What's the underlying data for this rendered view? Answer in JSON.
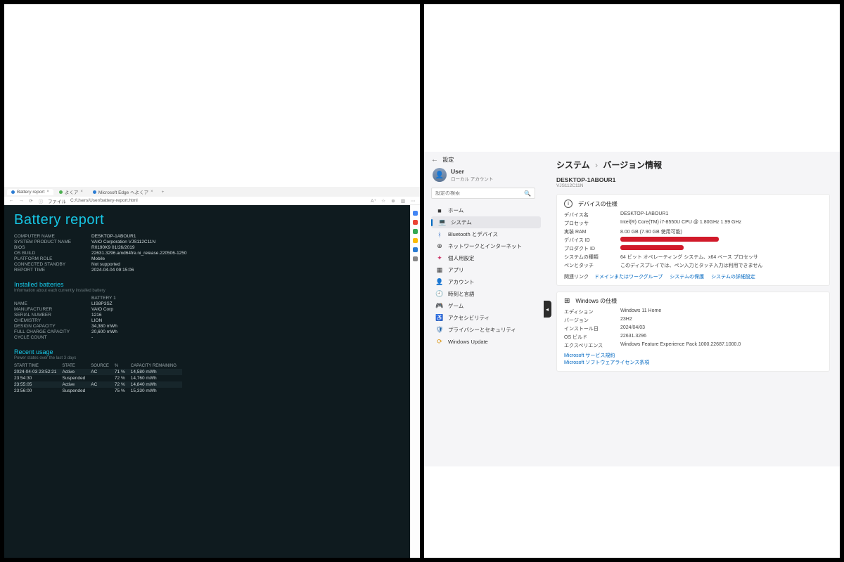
{
  "left": {
    "tabs": [
      {
        "label": "Battery report",
        "active": true
      },
      {
        "label": "よくア",
        "active": false
      },
      {
        "label": "Microsoft Edge へよくア",
        "active": false
      }
    ],
    "addr_prefix": "ファイル",
    "url": "C:/Users/User/battery-report.html",
    "title": "Battery report",
    "sys": [
      {
        "k": "COMPUTER NAME",
        "v": "DESKTOP-1ABOUR1"
      },
      {
        "k": "SYSTEM PRODUCT NAME",
        "v": "VAIO Corporation VJS112C11N"
      },
      {
        "k": "BIOS",
        "v": "R0190K9 01/26/2019"
      },
      {
        "k": "OS BUILD",
        "v": "22631.3296.amd64fre.ni_release.220506-1250"
      },
      {
        "k": "PLATFORM ROLE",
        "v": "Mobile"
      },
      {
        "k": "CONNECTED STANDBY",
        "v": "Not supported"
      },
      {
        "k": "REPORT TIME",
        "v": "2024-04-04 09:15:06"
      }
    ],
    "inst_title": "Installed batteries",
    "inst_sub": "Information about each currently installed battery",
    "batt_col": "BATTERY 1",
    "batt": [
      {
        "k": "NAME",
        "v": "LIS8P3SZ"
      },
      {
        "k": "MANUFACTURER",
        "v": "VAIO Corp"
      },
      {
        "k": "SERIAL NUMBER",
        "v": "1216"
      },
      {
        "k": "CHEMISTRY",
        "v": "LION"
      },
      {
        "k": "DESIGN CAPACITY",
        "v": "34,380 mWh"
      },
      {
        "k": "FULL CHARGE CAPACITY",
        "v": "20,600 mWh"
      },
      {
        "k": "CYCLE COUNT",
        "v": "-"
      }
    ],
    "recent_title": "Recent usage",
    "recent_sub": "Power states over the last 3 days",
    "recent_cols": [
      "START TIME",
      "STATE",
      "SOURCE",
      "%",
      "CAPACITY REMAINING"
    ],
    "recent": [
      {
        "t": "2024-04-03  23:52:21",
        "st": "Active",
        "src": "AC",
        "p": "71 %",
        "c": "14,580 mWh"
      },
      {
        "t": "23:54:30",
        "st": "Suspended",
        "src": "",
        "p": "72 %",
        "c": "14,760 mWh"
      },
      {
        "t": "23:55:05",
        "st": "Active",
        "src": "AC",
        "p": "72 %",
        "c": "14,840 mWh"
      },
      {
        "t": "23:56:00",
        "st": "Suspended",
        "src": "",
        "p": "75 %",
        "c": "15,330 mWh"
      }
    ]
  },
  "right": {
    "app_title": "設定",
    "user_name": "User",
    "user_sub": "ローカル アカウント",
    "search_ph": "設定の検索",
    "nav": [
      {
        "icon": "■",
        "cls": "ic-sys",
        "label": "ホーム"
      },
      {
        "icon": "💻",
        "cls": "ic-sys",
        "label": "システム",
        "sel": true
      },
      {
        "icon": "ᚼ",
        "cls": "ic-bt",
        "label": "Bluetooth とデバイス"
      },
      {
        "icon": "⊕",
        "cls": "ic-net",
        "label": "ネットワークとインターネット"
      },
      {
        "icon": "✦",
        "cls": "ic-pers",
        "label": "個人用設定"
      },
      {
        "icon": "▦",
        "cls": "ic-app",
        "label": "アプリ"
      },
      {
        "icon": "👤",
        "cls": "ic-acct",
        "label": "アカウント"
      },
      {
        "icon": "🕘",
        "cls": "ic-time",
        "label": "時刻と言語"
      },
      {
        "icon": "🎮",
        "cls": "ic-game",
        "label": "ゲーム"
      },
      {
        "icon": "♿",
        "cls": "ic-acc",
        "label": "アクセシビリティ"
      },
      {
        "icon": "🛡",
        "cls": "ic-priv",
        "label": "プライバシーとセキュリティ"
      },
      {
        "icon": "⟳",
        "cls": "ic-upd",
        "label": "Windows Update"
      }
    ],
    "crumb_sys": "システム",
    "crumb_sep": "›",
    "crumb_page": "バージョン情報",
    "dev_name": "DESKTOP-1ABOUR1",
    "dev_model": "VJS112C11N",
    "spec_title": "デバイスの仕様",
    "specs": [
      {
        "k": "デバイス名",
        "v": "DESKTOP-1ABOUR1"
      },
      {
        "k": "プロセッサ",
        "v": "Intel(R) Core(TM) i7-8550U CPU @ 1.80GHz   1.99 GHz"
      },
      {
        "k": "実装 RAM",
        "v": "8.00 GB (7.90 GB 使用可能)"
      },
      {
        "k": "デバイス ID",
        "v": "",
        "redact": 140
      },
      {
        "k": "プロダクト ID",
        "v": "",
        "redact": 90
      },
      {
        "k": "システムの種類",
        "v": "64 ビット オペレーティング システム、x64 ベース プロセッサ"
      },
      {
        "k": "ペンとタッチ",
        "v": "このディスプレイでは、ペン入力とタッチ入力は利用できません"
      }
    ],
    "links_label": "関連リンク",
    "links": [
      "ドメインまたはワークグループ",
      "システムの保護",
      "システムの詳細設定"
    ],
    "win_title": "Windows の仕様",
    "win": [
      {
        "k": "エディション",
        "v": "Windows 11 Home"
      },
      {
        "k": "バージョン",
        "v": "23H2"
      },
      {
        "k": "インストール日",
        "v": "2024/04/03"
      },
      {
        "k": "OS ビルド",
        "v": "22631.3296"
      },
      {
        "k": "エクスペリエンス",
        "v": "Windows Feature Experience Pack 1000.22687.1000.0"
      }
    ],
    "ms_links": [
      "Microsoft サービス規約",
      "Microsoft ソフトウェアライセンス条項"
    ]
  }
}
